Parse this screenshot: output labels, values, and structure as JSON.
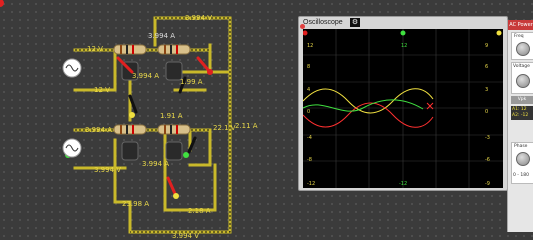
{
  "oscilloscope": {
    "title": "Oscilloscope",
    "settings_icon": "gear-icon",
    "ytick_left": [
      "12",
      "8",
      "4",
      "0",
      "-4",
      "-8",
      "-12"
    ],
    "ytick_right": [
      "9",
      "6",
      "3",
      "0",
      "-3",
      "-6",
      "-9"
    ],
    "ytick_green_top": "12",
    "ytick_green_bottom": "-12",
    "colors": {
      "ch1": "#f0e040",
      "ch2": "#ff3030",
      "ch3": "#40e040"
    }
  },
  "circuit": {
    "labels": {
      "w_top": "3.994 V",
      "w_r1_left": "12 V",
      "w_r1_mid": "3.994 A",
      "w_upper_mid": "3.994 A",
      "w_lower_left": "12 V",
      "w_right_a": "22.1 V",
      "w_right_b": "2.11 A",
      "w_center_a": "1.99 A",
      "w_center_b": "1.91 A",
      "w_bottom_mid": "3.994 V",
      "w_bottom_left": "23.98 A",
      "w_bottom_right": "2.18 A",
      "w_bottom_base": "3.994 V",
      "w_lower_mid": "3.994 A",
      "w_lower_right": "3.994 A"
    }
  },
  "side_panel": {
    "header": "AC Power",
    "box1_title": "Freq",
    "box2_title": "Voltage",
    "mini_label": "Vpk",
    "readout_lines": [
      "A1: 12",
      "A2: -12"
    ],
    "box3_title": "Phase",
    "box3_line": "0 - 180"
  }
}
